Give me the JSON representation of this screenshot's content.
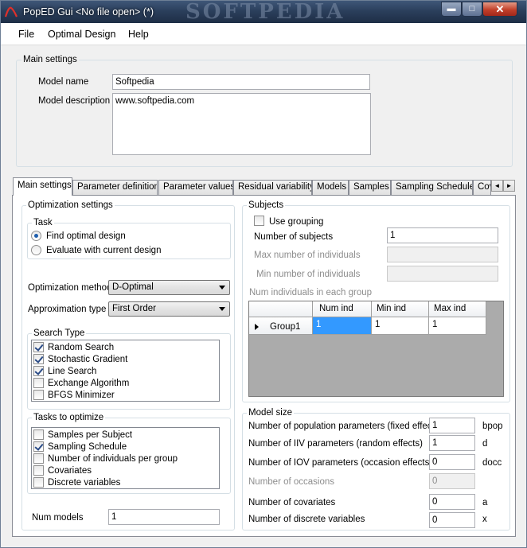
{
  "window": {
    "title": "PopED Gui <No file open> (*)",
    "watermark": "SOFTPEDIA",
    "buttons": {
      "minimize": "▬",
      "maximize": "□",
      "close": "✕"
    }
  },
  "menu": [
    "File",
    "Optimal Design",
    "Help"
  ],
  "main_settings": {
    "label": "Main settings",
    "model_name_label": "Model name",
    "model_name_value": "Softpedia",
    "model_description_label": "Model description",
    "model_description_value": "www.softpedia.com"
  },
  "tabs": [
    "Main settings",
    "Parameter definitions",
    "Parameter values",
    "Residual variability",
    "Models",
    "Samples",
    "Sampling Schedule",
    "Cov"
  ],
  "tab_scroll": {
    "left": "◄",
    "right": "►"
  },
  "optimization": {
    "label": "Optimization settings",
    "task": {
      "label": "Task",
      "options": [
        {
          "label": "Find optimal design",
          "selected": true
        },
        {
          "label": "Evaluate with current design",
          "selected": false
        }
      ]
    },
    "method_label": "Optimization method",
    "method_value": "D-Optimal",
    "approx_label": "Approximation type",
    "approx_value": "First Order",
    "search_type": {
      "label": "Search Type",
      "items": [
        {
          "label": "Random Search",
          "checked": true
        },
        {
          "label": "Stochastic Gradient",
          "checked": true
        },
        {
          "label": "Line Search",
          "checked": true
        },
        {
          "label": "Exchange Algorithm",
          "checked": false
        },
        {
          "label": "BFGS Minimizer",
          "checked": false
        }
      ]
    },
    "tasks_to_optimize": {
      "label": "Tasks to optimize",
      "items": [
        {
          "label": "Samples per Subject",
          "checked": false
        },
        {
          "label": "Sampling Schedule",
          "checked": true
        },
        {
          "label": "Number of individuals per group",
          "checked": false
        },
        {
          "label": "Covariates",
          "checked": false
        },
        {
          "label": "Discrete variables",
          "checked": false
        }
      ]
    },
    "num_models_label": "Num models",
    "num_models_value": "1"
  },
  "subjects": {
    "label": "Subjects",
    "use_grouping_label": "Use grouping",
    "use_grouping_checked": false,
    "num_subjects_label": "Number of subjects",
    "num_subjects_value": "1",
    "max_ind_label": "Max number of individuals",
    "min_ind_label": "Min number of individuals",
    "grid_label": "Num individuals in each group",
    "grid": {
      "headers": [
        "Num ind",
        "Min ind",
        "Max ind"
      ],
      "rows": [
        {
          "name": "Group1",
          "values": [
            "1",
            "1",
            "1"
          ]
        }
      ]
    }
  },
  "model_size": {
    "label": "Model size",
    "rows": [
      {
        "label": "Number of population parameters (fixed effects)",
        "value": "1",
        "unit": "bpop",
        "enabled": true
      },
      {
        "label": "Number of IIV parameters (random effects)",
        "value": "1",
        "unit": "d",
        "enabled": true
      },
      {
        "label": "Number of IOV parameters (occasion effects)",
        "value": "0",
        "unit": "docc",
        "enabled": true
      },
      {
        "label": "Number of occasions",
        "value": "0",
        "unit": "",
        "enabled": false
      },
      {
        "label": "Number of covariates",
        "value": "0",
        "unit": "a",
        "enabled": true
      },
      {
        "label": "Number of discrete variables",
        "value": "0",
        "unit": "x",
        "enabled": true
      }
    ]
  },
  "colors": {
    "title_bar": "#2b3f5c",
    "selection": "#3399ff",
    "grid_bg": "#ababab"
  }
}
